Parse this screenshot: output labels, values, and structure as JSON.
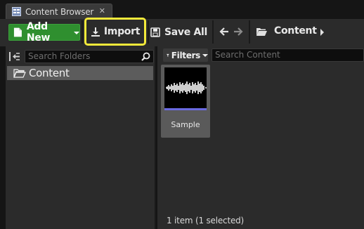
{
  "tab": {
    "title": "Content Browser",
    "icon": "content-browser-icon",
    "close_glyph": "✕"
  },
  "toolbar": {
    "add_new_label": "Add New",
    "import_label": "Import",
    "save_all_label": "Save All",
    "path_label": "Content",
    "highlight_color": "#f3e93a",
    "add_new_color": "#2f8f2f"
  },
  "left_panel": {
    "search_placeholder": "Search Folders",
    "tree": [
      {
        "label": "Content"
      }
    ]
  },
  "right_panel": {
    "filters_label": "Filters",
    "search_placeholder": "Search Content",
    "assets": [
      {
        "name": "Sample",
        "type": "sound-wave",
        "type_bar_color": "#6a6ae0"
      }
    ],
    "status": "1 item (1 selected)"
  }
}
